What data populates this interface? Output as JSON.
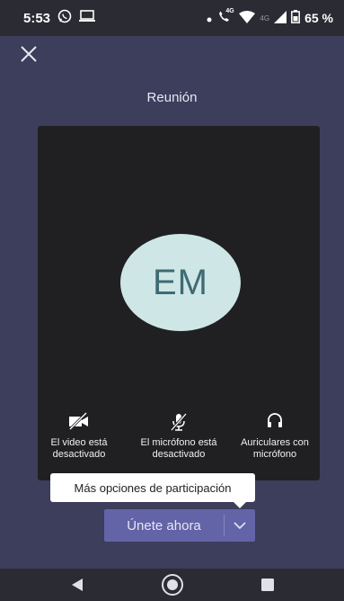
{
  "status_bar": {
    "time": "5:53",
    "battery": "65 %",
    "net_4g_a": "4G",
    "net_4g_b": "4G",
    "icons": [
      "whatsapp-icon",
      "cast-icon",
      "call-signal-icon",
      "wifi-icon",
      "signal-icon",
      "battery-icon"
    ]
  },
  "header": {
    "close_icon": "close-icon",
    "title": "Reunión"
  },
  "preview": {
    "avatar_initials": "EM",
    "avatar_color": "#cfe6e6",
    "controls": [
      {
        "icon": "video-off-icon",
        "label": "El video está desactivado"
      },
      {
        "icon": "mic-off-icon",
        "label": "El micrófono está desactivado"
      },
      {
        "icon": "headset-icon",
        "label": "Auriculares con micrófono"
      }
    ]
  },
  "tooltip": {
    "text": "Más opciones de participación"
  },
  "join": {
    "label": "Únete ahora",
    "accent": "#6264a7",
    "dropdown_icon": "chevron-down-icon"
  },
  "nav": {
    "icons": [
      "back-icon",
      "home-icon",
      "recents-icon"
    ]
  }
}
